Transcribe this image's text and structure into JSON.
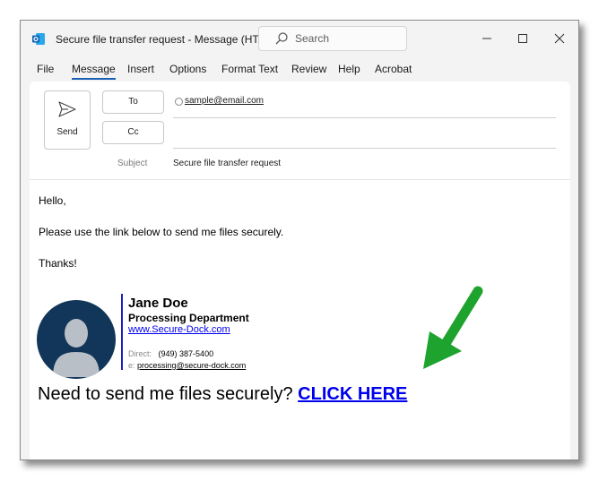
{
  "window": {
    "title": "Secure file transfer request  -  Message (HTML)",
    "search_placeholder": "Search"
  },
  "menu": [
    "File",
    "Message",
    "Insert",
    "Options",
    "Format Text",
    "Review",
    "Help",
    "Acrobat"
  ],
  "compose": {
    "send_label": "Send",
    "to_label": "To",
    "cc_label": "Cc",
    "to_value": "sample@email.com",
    "cc_value": "",
    "subject_label": "Subject",
    "subject_value": "Secure file transfer request"
  },
  "body": {
    "greeting": "Hello,",
    "line1": "Please use the link below to send me files securely.",
    "closing": "Thanks!"
  },
  "signature": {
    "name": "Jane Doe",
    "department": "Processing Department",
    "website": "www.Secure-Dock.com",
    "direct_label": "Direct:",
    "direct_value": "(949) 387-5400",
    "email_label": "e:",
    "email_value": "processing@secure-dock.com"
  },
  "cta": {
    "text": "Need to send me files securely?",
    "link": "CLICK HERE"
  },
  "colors": {
    "accent": "#1a5fb4",
    "link": "#0000ee",
    "arrow": "#1ea32e",
    "avatar_bg": "#12365a"
  }
}
